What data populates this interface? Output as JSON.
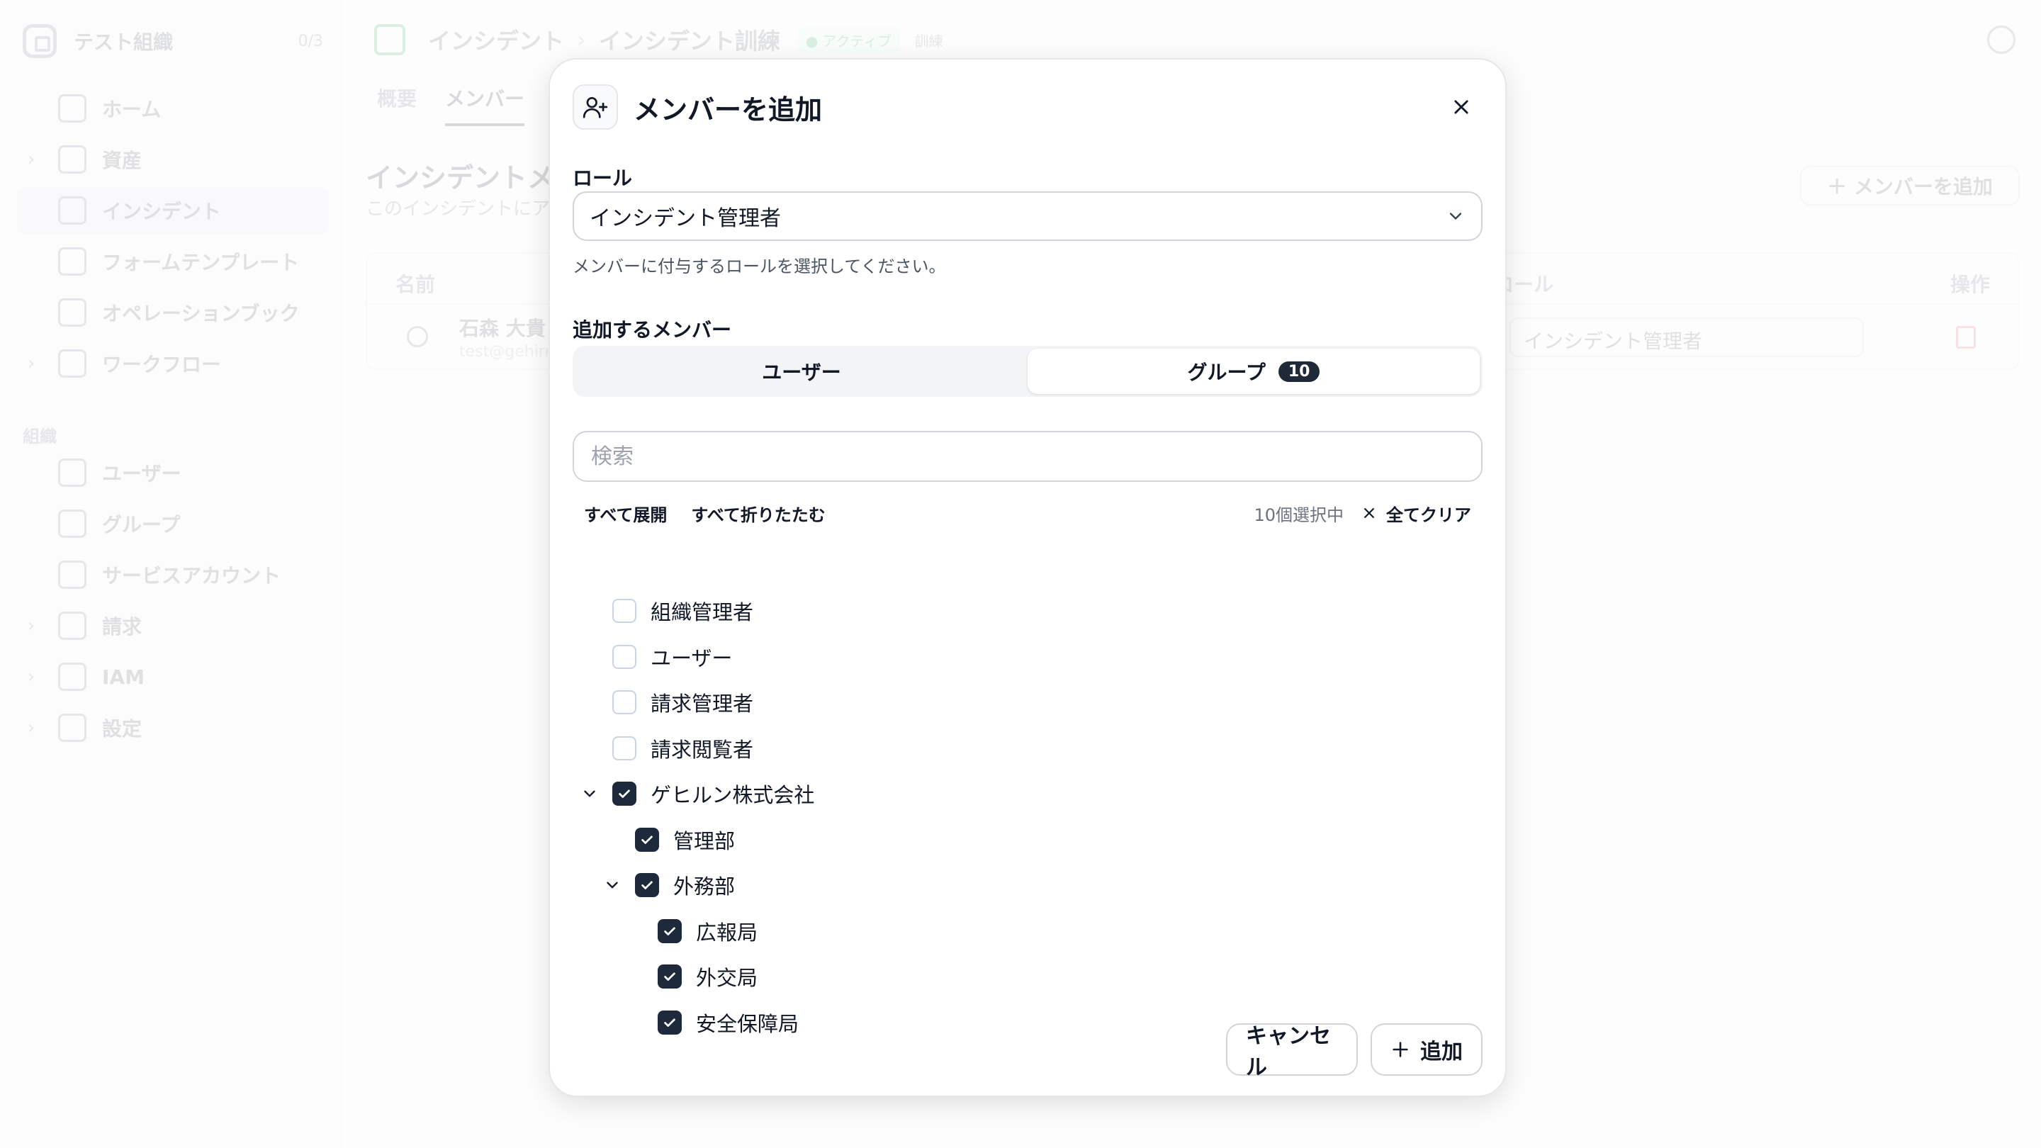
{
  "background": {
    "org": {
      "name": "テスト組織",
      "count": "0/3"
    },
    "nav": [
      {
        "label": "ホーム",
        "icon": "home-icon"
      },
      {
        "label": "資産",
        "icon": "box-icon"
      },
      {
        "label": "インシデント",
        "icon": "incident-icon"
      },
      {
        "label": "フォームテンプレート",
        "icon": "form-icon"
      },
      {
        "label": "オペレーションブック",
        "icon": "book-icon"
      },
      {
        "label": "ワークフロー",
        "icon": "workflow-icon"
      }
    ],
    "section_label": "組織",
    "nav2": [
      {
        "label": "ユーザー",
        "icon": "users-icon"
      },
      {
        "label": "グループ",
        "icon": "group-icon"
      },
      {
        "label": "サービスアカウント",
        "icon": "service-account-icon"
      },
      {
        "label": "請求",
        "icon": "billing-icon"
      },
      {
        "label": "IAM",
        "icon": "iam-icon"
      },
      {
        "label": "設定",
        "icon": "settings-icon"
      }
    ],
    "breadcrumb": [
      "インシデント",
      "インシデント訓練"
    ],
    "status_badge": "● アクティブ",
    "mode_badge": "訓練",
    "tabs": [
      "概要",
      "メンバー"
    ],
    "page_title": "インシデントメンバー",
    "page_subtitle": "このインシデントにア",
    "add_member_button": "＋ メンバーを追加",
    "table": {
      "headers": [
        "名前",
        "ロール",
        "操作"
      ],
      "row": {
        "name": "石森 大貴",
        "email": "test@gehirn",
        "role": "インシデント管理者"
      }
    }
  },
  "modal": {
    "title": "メンバーを追加",
    "role_label": "ロール",
    "role_value": "インシデント管理者",
    "role_hint": "メンバーに付与するロールを選択してください。",
    "members_label": "追加するメンバー",
    "segments": {
      "users": "ユーザー",
      "groups": "グループ",
      "groups_count": "10",
      "active": "groups"
    },
    "search_placeholder": "検索",
    "expand_all": "すべて展開",
    "collapse_all": "すべて折りたたむ",
    "selected_count": "10個選択中",
    "clear_all": "全てクリア",
    "tree": [
      {
        "label": "組織管理者",
        "checked": false,
        "level": 0,
        "expandable": false
      },
      {
        "label": "ユーザー",
        "checked": false,
        "level": 0,
        "expandable": false
      },
      {
        "label": "請求管理者",
        "checked": false,
        "level": 0,
        "expandable": false
      },
      {
        "label": "請求閲覧者",
        "checked": false,
        "level": 0,
        "expandable": false
      },
      {
        "label": "ゲヒルン株式会社",
        "checked": true,
        "level": 0,
        "expandable": true
      },
      {
        "label": "管理部",
        "checked": true,
        "level": 1,
        "expandable": false
      },
      {
        "label": "外務部",
        "checked": true,
        "level": 1,
        "expandable": true
      },
      {
        "label": "広報局",
        "checked": true,
        "level": 2,
        "expandable": false
      },
      {
        "label": "外交局",
        "checked": true,
        "level": 2,
        "expandable": false
      },
      {
        "label": "安全保障局",
        "checked": true,
        "level": 2,
        "expandable": false
      }
    ],
    "cancel": "キャンセル",
    "add": "追加"
  }
}
